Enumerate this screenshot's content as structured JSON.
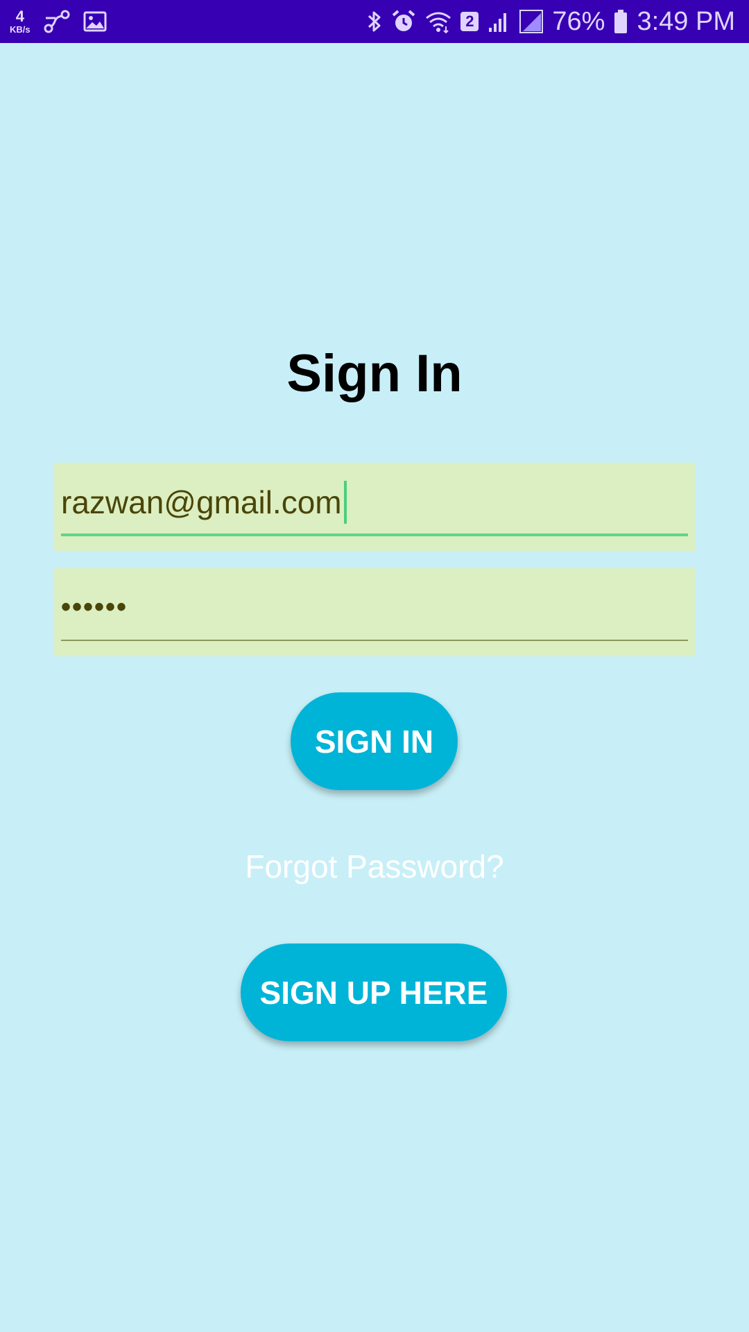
{
  "status_bar": {
    "speed_value": "4",
    "speed_unit": "KB/s",
    "sim_number": "2",
    "battery_percent": "76%",
    "time": "3:49 PM",
    "left_icons": [
      "share-nodes-icon",
      "image-icon"
    ],
    "right_icons": [
      "bluetooth-icon",
      "alarm-icon",
      "wifi-icon",
      "sim-icon",
      "signal-icon",
      "signal-icon",
      "battery-icon"
    ]
  },
  "screen": {
    "title": "Sign In",
    "email_value": "razwan@gmail.com",
    "password_value": "••••••",
    "signin_button_label": "SIGN IN",
    "forgot_link_label": "Forgot Password?",
    "signup_button_label": "SIGN UP HERE"
  },
  "colors": {
    "status_bar": "#3700b3",
    "background": "#c8eff7",
    "field_background": "#dcefc2",
    "focused_underline": "#5cd68a",
    "button": "#00b4d8",
    "input_text": "#4a4508"
  }
}
